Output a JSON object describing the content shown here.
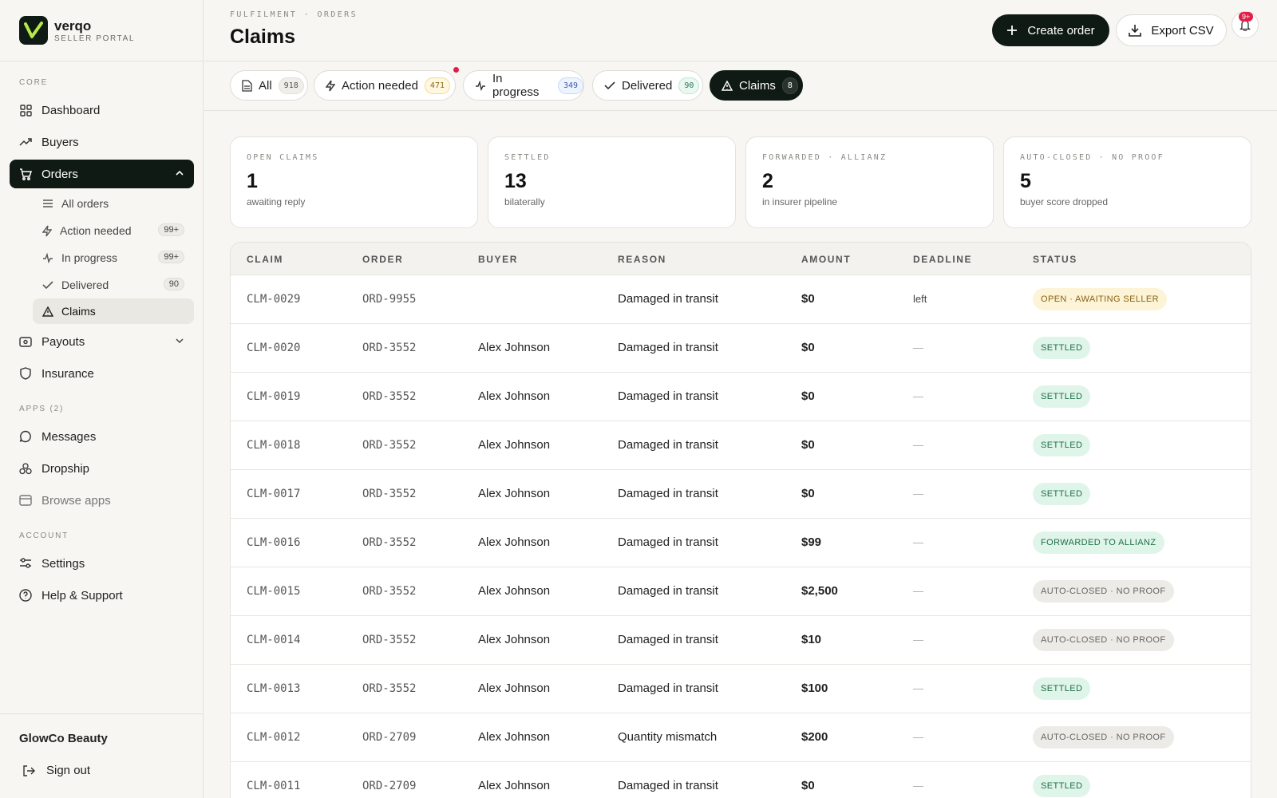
{
  "brand": {
    "name": "verqo",
    "subtitle": "SELLER PORTAL"
  },
  "sidebar": {
    "core_label": "CORE",
    "apps_label": "APPS (2)",
    "account_label": "ACCOUNT",
    "items": {
      "dashboard": "Dashboard",
      "buyers": "Buyers",
      "orders": "Orders",
      "payouts": "Payouts",
      "insurance": "Insurance",
      "messages": "Messages",
      "dropship": "Dropship",
      "browse_apps": "Browse apps",
      "settings": "Settings",
      "help": "Help & Support"
    },
    "orders_sub": {
      "all": "All orders",
      "action": "Action needed",
      "action_badge": "99+",
      "progress": "In progress",
      "progress_badge": "99+",
      "delivered": "Delivered",
      "delivered_badge": "90",
      "claims": "Claims"
    },
    "org_name": "GlowCo Beauty",
    "sign_out": "Sign out"
  },
  "header": {
    "breadcrumb": "FULFILMENT · ORDERS",
    "title": "Claims",
    "create_label": "Create order",
    "export_label": "Export CSV",
    "notif_badge": "9+"
  },
  "tabs": [
    {
      "label": "All",
      "count": "918"
    },
    {
      "label": "Action needed",
      "count": "471"
    },
    {
      "label": "In progress",
      "count": "349"
    },
    {
      "label": "Delivered",
      "count": "90"
    },
    {
      "label": "Claims",
      "count": "8"
    }
  ],
  "stats": [
    {
      "label": "OPEN CLAIMS",
      "value": "1",
      "sub": "awaiting reply"
    },
    {
      "label": "SETTLED",
      "value": "13",
      "sub": "bilaterally"
    },
    {
      "label": "FORWARDED · ALLIANZ",
      "value": "2",
      "sub": "in insurer pipeline"
    },
    {
      "label": "AUTO-CLOSED · NO PROOF",
      "value": "5",
      "sub": "buyer score dropped"
    }
  ],
  "table": {
    "columns": [
      "CLAIM",
      "ORDER",
      "BUYER",
      "REASON",
      "AMOUNT",
      "DEADLINE",
      "STATUS"
    ],
    "rows": [
      {
        "claim": "CLM-0029",
        "order": "ORD-9955",
        "buyer": "",
        "reason": "Damaged in transit",
        "amount": "$0",
        "deadline": "left",
        "status": "OPEN · AWAITING SELLER"
      },
      {
        "claim": "CLM-0020",
        "order": "ORD-3552",
        "buyer": "Alex Johnson",
        "reason": "Damaged in transit",
        "amount": "$0",
        "deadline": "—",
        "status": "SETTLED"
      },
      {
        "claim": "CLM-0019",
        "order": "ORD-3552",
        "buyer": "Alex Johnson",
        "reason": "Damaged in transit",
        "amount": "$0",
        "deadline": "—",
        "status": "SETTLED"
      },
      {
        "claim": "CLM-0018",
        "order": "ORD-3552",
        "buyer": "Alex Johnson",
        "reason": "Damaged in transit",
        "amount": "$0",
        "deadline": "—",
        "status": "SETTLED"
      },
      {
        "claim": "CLM-0017",
        "order": "ORD-3552",
        "buyer": "Alex Johnson",
        "reason": "Damaged in transit",
        "amount": "$0",
        "deadline": "—",
        "status": "SETTLED"
      },
      {
        "claim": "CLM-0016",
        "order": "ORD-3552",
        "buyer": "Alex Johnson",
        "reason": "Damaged in transit",
        "amount": "$99",
        "deadline": "—",
        "status": "FORWARDED TO ALLIANZ"
      },
      {
        "claim": "CLM-0015",
        "order": "ORD-3552",
        "buyer": "Alex Johnson",
        "reason": "Damaged in transit",
        "amount": "$2,500",
        "deadline": "—",
        "status": "AUTO-CLOSED · NO PROOF"
      },
      {
        "claim": "CLM-0014",
        "order": "ORD-3552",
        "buyer": "Alex Johnson",
        "reason": "Damaged in transit",
        "amount": "$10",
        "deadline": "—",
        "status": "AUTO-CLOSED · NO PROOF"
      },
      {
        "claim": "CLM-0013",
        "order": "ORD-3552",
        "buyer": "Alex Johnson",
        "reason": "Damaged in transit",
        "amount": "$100",
        "deadline": "—",
        "status": "SETTLED"
      },
      {
        "claim": "CLM-0012",
        "order": "ORD-2709",
        "buyer": "Alex Johnson",
        "reason": "Quantity mismatch",
        "amount": "$200",
        "deadline": "—",
        "status": "AUTO-CLOSED · NO PROOF"
      },
      {
        "claim": "CLM-0011",
        "order": "ORD-2709",
        "buyer": "Alex Johnson",
        "reason": "Damaged in transit",
        "amount": "$0",
        "deadline": "—",
        "status": "SETTLED"
      }
    ]
  },
  "colors": {
    "accent_dark": "#0f1a14",
    "brand_green": "#b6e84a",
    "alert": "#e11d48"
  }
}
